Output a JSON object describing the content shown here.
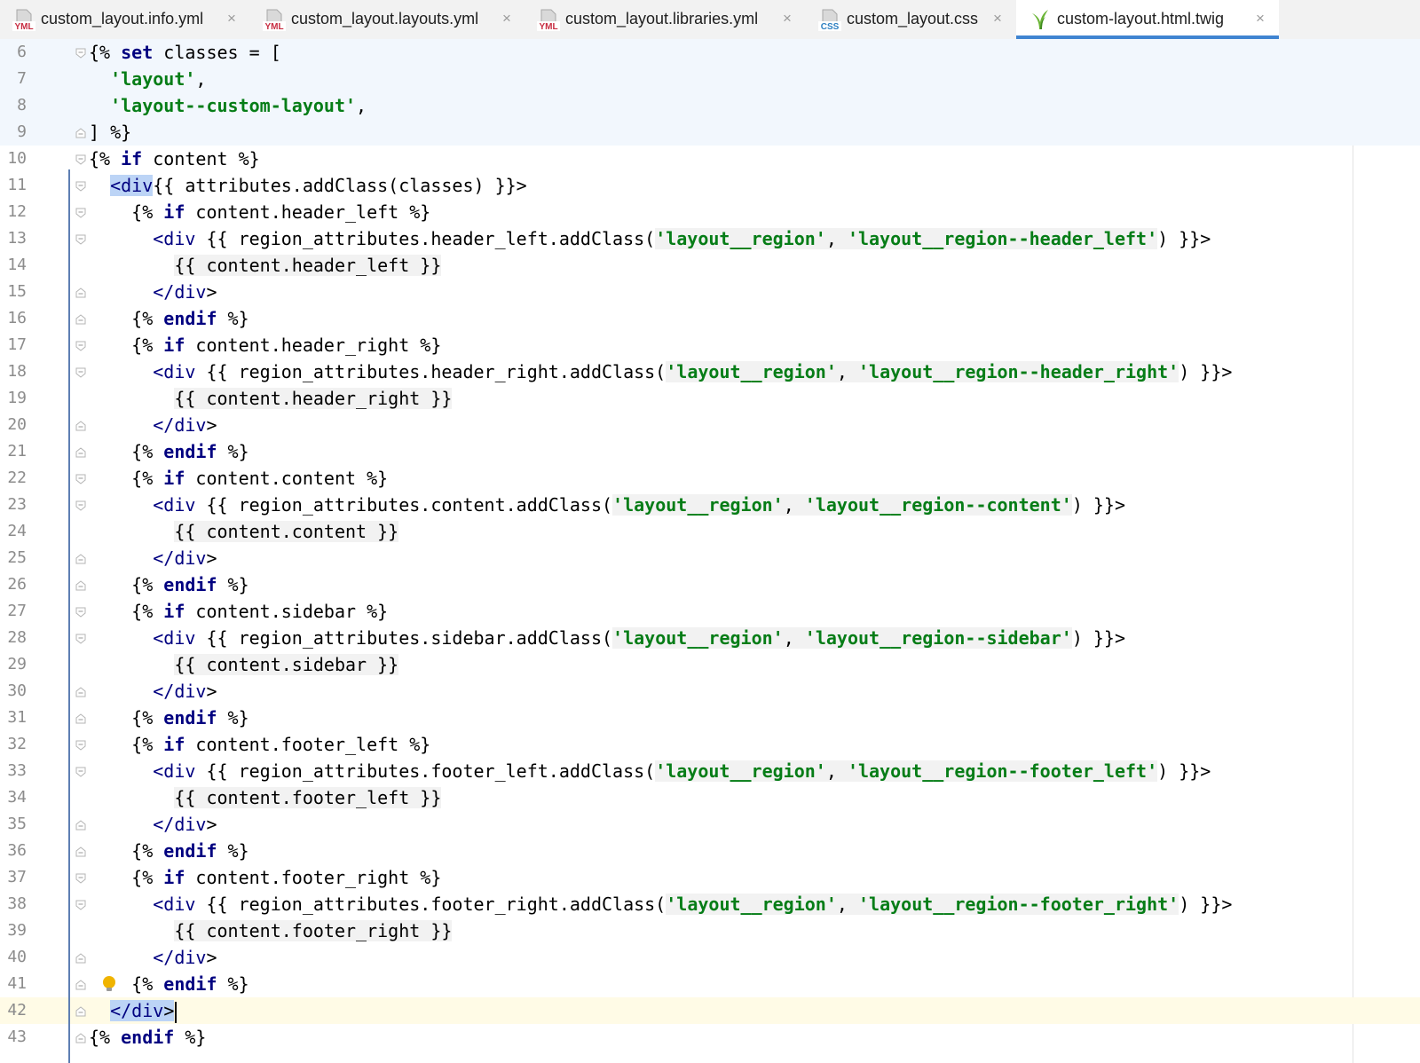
{
  "tabs": [
    {
      "label": "custom_layout.info.yml",
      "icon": "yml-file-icon",
      "active": false
    },
    {
      "label": "custom_layout.layouts.yml",
      "icon": "yml-file-icon",
      "active": false
    },
    {
      "label": "custom_layout.libraries.yml",
      "icon": "yml-file-icon",
      "active": false
    },
    {
      "label": "custom_layout.css",
      "icon": "css-file-icon",
      "active": false
    },
    {
      "label": "custom-layout.html.twig",
      "icon": "twig-file-icon",
      "active": true
    }
  ],
  "icons": {
    "yml_badge": "YML",
    "css_badge": "CSS",
    "close": "×"
  },
  "colors": {
    "keyword": "#000080",
    "string": "#067d17",
    "active_tab_accent": "#3f84d1",
    "intention_bulb": "#f0b400"
  },
  "editor": {
    "current_line": 42,
    "lines": [
      {
        "n": 6,
        "text": "{% set classes = ["
      },
      {
        "n": 7,
        "text": "  'layout',"
      },
      {
        "n": 8,
        "text": "  'layout--custom-layout',"
      },
      {
        "n": 9,
        "text": "] %}"
      },
      {
        "n": 10,
        "text": "{% if content %}"
      },
      {
        "n": 11,
        "text": "  <div{{ attributes.addClass(classes) }}>"
      },
      {
        "n": 12,
        "text": "    {% if content.header_left %}"
      },
      {
        "n": 13,
        "text": "      <div {{ region_attributes.header_left.addClass('layout__region', 'layout__region--header_left') }}>"
      },
      {
        "n": 14,
        "text": "        {{ content.header_left }}"
      },
      {
        "n": 15,
        "text": "      </div>"
      },
      {
        "n": 16,
        "text": "    {% endif %}"
      },
      {
        "n": 17,
        "text": "    {% if content.header_right %}"
      },
      {
        "n": 18,
        "text": "      <div {{ region_attributes.header_right.addClass('layout__region', 'layout__region--header_right') }}>"
      },
      {
        "n": 19,
        "text": "        {{ content.header_right }}"
      },
      {
        "n": 20,
        "text": "      </div>"
      },
      {
        "n": 21,
        "text": "    {% endif %}"
      },
      {
        "n": 22,
        "text": "    {% if content.content %}"
      },
      {
        "n": 23,
        "text": "      <div {{ region_attributes.content.addClass('layout__region', 'layout__region--content') }}>"
      },
      {
        "n": 24,
        "text": "        {{ content.content }}"
      },
      {
        "n": 25,
        "text": "      </div>"
      },
      {
        "n": 26,
        "text": "    {% endif %}"
      },
      {
        "n": 27,
        "text": "    {% if content.sidebar %}"
      },
      {
        "n": 28,
        "text": "      <div {{ region_attributes.sidebar.addClass('layout__region', 'layout__region--sidebar') }}>"
      },
      {
        "n": 29,
        "text": "        {{ content.sidebar }}"
      },
      {
        "n": 30,
        "text": "      </div>"
      },
      {
        "n": 31,
        "text": "    {% endif %}"
      },
      {
        "n": 32,
        "text": "    {% if content.footer_left %}"
      },
      {
        "n": 33,
        "text": "      <div {{ region_attributes.footer_left.addClass('layout__region', 'layout__region--footer_left') }}>"
      },
      {
        "n": 34,
        "text": "        {{ content.footer_left }}"
      },
      {
        "n": 35,
        "text": "      </div>"
      },
      {
        "n": 36,
        "text": "    {% endif %}"
      },
      {
        "n": 37,
        "text": "    {% if content.footer_right %}"
      },
      {
        "n": 38,
        "text": "      <div {{ region_attributes.footer_right.addClass('layout__region', 'layout__region--footer_right') }}>"
      },
      {
        "n": 39,
        "text": "        {{ content.footer_right }}"
      },
      {
        "n": 40,
        "text": "      </div>"
      },
      {
        "n": 41,
        "text": "    {% endif %}"
      },
      {
        "n": 42,
        "text": "  </div>"
      },
      {
        "n": 43,
        "text": "{% endif %}"
      }
    ]
  }
}
